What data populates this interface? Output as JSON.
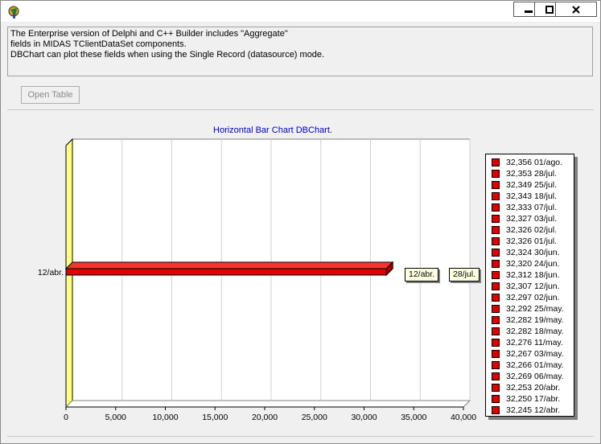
{
  "window": {
    "controls": {
      "minimize": "▬",
      "maximize": "▢",
      "close": "✕"
    },
    "icon": "delphi-app-icon"
  },
  "info": {
    "lines": [
      "The Enterprise version of Delphi and C++ Builder includes \"Aggregate\"",
      "fields in MIDAS TClientDataSet components.",
      "",
      "DBChart can plot these fields when using the Single Record (datasource) mode."
    ]
  },
  "toolbar": {
    "open_table_label": "Open Table"
  },
  "colors": {
    "bar": "#e00000",
    "back_wall": "#ffff80",
    "accent": "#0000c0"
  },
  "chart_data": {
    "type": "bar",
    "orientation": "horizontal",
    "title": "Horizontal Bar Chart DBChart.",
    "categories": [
      "12/abr."
    ],
    "values": [
      32245
    ],
    "xlim": [
      0,
      40000
    ],
    "xticks": [
      "0",
      "5,000",
      "10,000",
      "15,000",
      "20,000",
      "25,000",
      "30,000",
      "35,000",
      "40,000"
    ],
    "xtick_values": [
      0,
      5000,
      10000,
      15000,
      20000,
      25000,
      30000,
      35000,
      40000
    ],
    "grid": true,
    "legend_position": "right",
    "marks": [
      "12/abr.",
      "28/jul."
    ],
    "legend": [
      {
        "value": "32,356",
        "label": "01/ago."
      },
      {
        "value": "32,353",
        "label": "28/jul."
      },
      {
        "value": "32,349",
        "label": "25/jul."
      },
      {
        "value": "32,343",
        "label": "18/jul."
      },
      {
        "value": "32,333",
        "label": "07/jul."
      },
      {
        "value": "32,327",
        "label": "03/jul."
      },
      {
        "value": "32,326",
        "label": "02/jul."
      },
      {
        "value": "32,326",
        "label": "01/jul."
      },
      {
        "value": "32,324",
        "label": "30/jun."
      },
      {
        "value": "32,320",
        "label": "24/jun."
      },
      {
        "value": "32,312",
        "label": "18/jun."
      },
      {
        "value": "32,307",
        "label": "12/jun."
      },
      {
        "value": "32,297",
        "label": "02/jun."
      },
      {
        "value": "32,292",
        "label": "25/may."
      },
      {
        "value": "32,282",
        "label": "19/may."
      },
      {
        "value": "32,282",
        "label": "18/may."
      },
      {
        "value": "32,276",
        "label": "11/may."
      },
      {
        "value": "32,267",
        "label": "03/may."
      },
      {
        "value": "32,266",
        "label": "01/may."
      },
      {
        "value": "32,269",
        "label": "06/may."
      },
      {
        "value": "32,253",
        "label": "20/abr."
      },
      {
        "value": "32,250",
        "label": "17/abr."
      },
      {
        "value": "32,245",
        "label": "12/abr."
      }
    ]
  }
}
